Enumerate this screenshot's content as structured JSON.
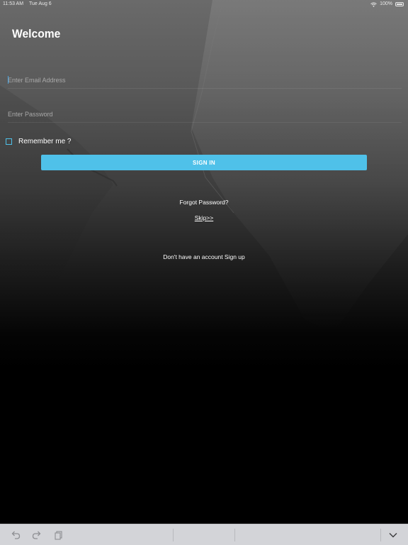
{
  "status_bar": {
    "time": "11:53 AM",
    "date": "Tue Aug 6",
    "battery": "100%",
    "wifi_icon": "wifi-icon",
    "battery_icon": "battery-icon"
  },
  "login": {
    "title": "Welcome",
    "email_placeholder": "Enter Email Address",
    "password_placeholder": "Enter Password",
    "remember_label": "Remember me ?",
    "signin_label": "SIGN IN",
    "forgot_label": "Forgot Password?",
    "skip_label": "Skip>>",
    "signup_label": "Don't have an account Sign up"
  },
  "keyboard_toolbar": {
    "undo_icon": "undo-icon",
    "redo_icon": "redo-icon",
    "paste_icon": "clipboard-icon",
    "dismiss_icon": "chevron-down-icon"
  },
  "colors": {
    "accent": "#4fc1e9",
    "text": "#ffffff",
    "toolbar_bg": "#d3d4d8"
  }
}
